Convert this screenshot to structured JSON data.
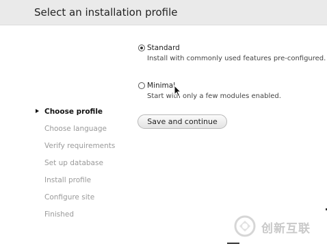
{
  "header": {
    "title": "Select an installation profile"
  },
  "steps": [
    {
      "label": "Choose profile",
      "active": true
    },
    {
      "label": "Choose language",
      "active": false
    },
    {
      "label": "Verify requirements",
      "active": false
    },
    {
      "label": "Set up database",
      "active": false
    },
    {
      "label": "Install profile",
      "active": false
    },
    {
      "label": "Configure site",
      "active": false
    },
    {
      "label": "Finished",
      "active": false
    }
  ],
  "profiles": [
    {
      "label": "Standard",
      "description": "Install with commonly used features pre-configured.",
      "selected": true
    },
    {
      "label": "Minimal",
      "description": "Start with only a few modules enabled.",
      "selected": false
    }
  ],
  "actions": {
    "submit_label": "Save and continue"
  },
  "watermark": {
    "text": "创新互联"
  },
  "icons": {
    "active_step": "triangle-right-icon",
    "cursor": "mouse-pointer-icon",
    "watermark": "brand-logo-icon"
  }
}
